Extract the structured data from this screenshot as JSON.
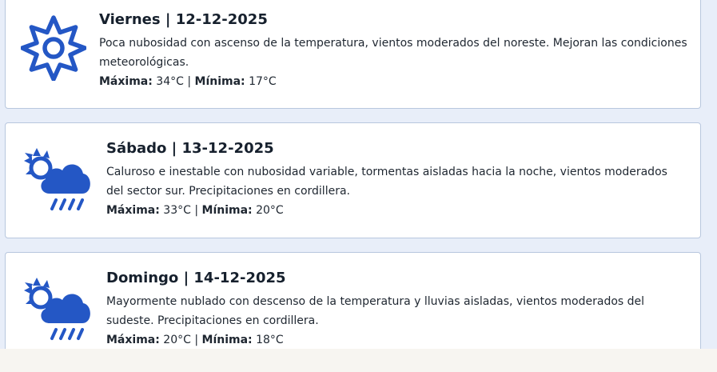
{
  "colors": {
    "icon_blue": "#2457c5",
    "card_border": "#b8c7de",
    "page_bg": "#e8eef9"
  },
  "labels": {
    "max": "Máxima:",
    "min": "Mínima:",
    "sep": " | "
  },
  "forecast": [
    {
      "title": "Viernes | 12-12-2025",
      "description": "Poca nubosidad con ascenso de la temperatura, vientos moderados del noreste. Mejoran las condiciones meteorológicas.",
      "max": " 34°C",
      "min": " 17°C",
      "icon": "sun-icon"
    },
    {
      "title": "Sábado | 13-12-2025",
      "description": "Caluroso e inestable con nubosidad variable, tormentas aisladas hacia la noche, vientos moderados del sector sur. Precipitaciones en cordillera.",
      "max": " 33°C",
      "min": " 20°C",
      "icon": "partly-cloudy-rain-icon"
    },
    {
      "title": "Domingo | 14-12-2025",
      "description": "Mayormente nublado con descenso de la temperatura y lluvias aisladas, vientos moderados del sudeste. Precipitaciones en cordillera.",
      "max": " 20°C",
      "min": " 18°C",
      "icon": "partly-cloudy-rain-icon"
    }
  ]
}
